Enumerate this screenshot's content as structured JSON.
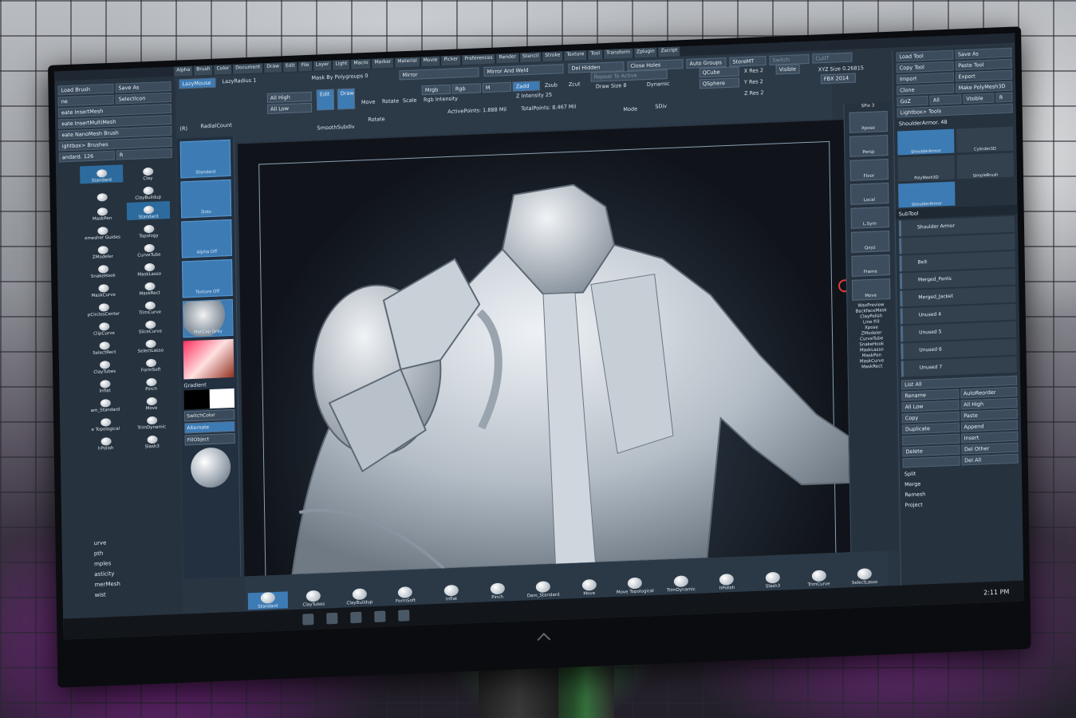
{
  "app": {
    "title_fragment": "ush"
  },
  "menu": [
    "Alpha",
    "Brush",
    "Color",
    "Document",
    "Draw",
    "Edit",
    "File",
    "Layer",
    "Light",
    "Macro",
    "Marker",
    "Material",
    "Movie",
    "Picker",
    "Preferences",
    "Render",
    "Stencil",
    "Stroke",
    "Texture",
    "Tool",
    "Transform",
    "Zplugin",
    "Zscript"
  ],
  "top_fields": {
    "lazymouse": "LazyMouse",
    "lazyradius": "LazyRadius 1",
    "mask_by_polygroups": "Mask By Polygroups 0",
    "mirror": "Mirror",
    "mirror_and_weld": "Mirror And Weld",
    "del_hidden": "Del Hidden",
    "close_holes": "Close Holes",
    "auto_groups": "Auto Groups",
    "store_mt": "StoreMT",
    "switch": "Switch",
    "cont": "CutIT",
    "xyz_size": "XYZ Size 0.26815",
    "all_high": "All High",
    "all_low": "All Low",
    "edit": "Edit",
    "draw": "Draw",
    "move": "Move",
    "rotate": "Rotate",
    "scale": "Scale",
    "mrgb": "Mrgb",
    "rgb": "Rgb",
    "m": "M",
    "zadd": "Zadd",
    "zsub": "Zsub",
    "zcut": "Zcut",
    "rgb_intensity": "Rgb Intensity",
    "z_intensity": "Z Intensity 25",
    "active_points": "ActivePoints: 1.888 Mil",
    "total_points": "TotalPoints: 8.467 Mil",
    "radial_count": "RadialCount",
    "smooth_subdiv": "SmoothSubdiv",
    "rotate2": "Rotate",
    "repeat_to_active": "Repeat To Active",
    "draw_size": "Draw Size 8",
    "dynamic": "Dynamic",
    "qcube": "QCube",
    "qsphere": "QSphere",
    "x_res": "X Res 2",
    "y_res": "Y Res 2",
    "z_res": "Z Res 2",
    "visible": "Visible",
    "fbx": "FBX 2014",
    "sdiv": "SDiv",
    "mode": "Mode",
    "r_label": "(R)"
  },
  "left_buttons": [
    [
      "Load Brush",
      "Save As"
    ],
    [
      "ne",
      "SelectIcon"
    ],
    [
      "eate InsertMesh"
    ],
    [
      "eate InsertMultiMesh"
    ],
    [
      "eate NanoMesh Brush"
    ],
    [
      "ightbox> Brushes"
    ],
    [
      "andard. 126",
      "R"
    ]
  ],
  "brushes": [
    {
      "name": "Standard",
      "sel": true
    },
    {
      "name": "Clay",
      "sel": false
    },
    {
      "name": "",
      "sel": false
    },
    {
      "name": "ClayBuildup",
      "sel": false
    },
    {
      "name": "MaskPen",
      "sel": false
    },
    {
      "name": "Standard",
      "sel": true
    },
    {
      "name": "emesher Guides",
      "sel": false
    },
    {
      "name": "Topology",
      "sel": false
    },
    {
      "name": "ZModeler",
      "sel": false
    },
    {
      "name": "CurveTube",
      "sel": false
    },
    {
      "name": "SnakeHook",
      "sel": false
    },
    {
      "name": "MaskLasso",
      "sel": false
    },
    {
      "name": "MaskCurve",
      "sel": false
    },
    {
      "name": "MaskRect",
      "sel": false
    },
    {
      "name": "pCirclesCenter",
      "sel": false
    },
    {
      "name": "TrimCurve",
      "sel": false
    },
    {
      "name": "ClipCurve",
      "sel": false
    },
    {
      "name": "SliceCurve",
      "sel": false
    },
    {
      "name": "SelectRect",
      "sel": false
    },
    {
      "name": "SelectLasso",
      "sel": false
    },
    {
      "name": "ClayTubes",
      "sel": false
    },
    {
      "name": "FormSoft",
      "sel": false
    },
    {
      "name": "Inflat",
      "sel": false
    },
    {
      "name": "Pinch",
      "sel": false
    },
    {
      "name": "am_Standard",
      "sel": false
    },
    {
      "name": "Move",
      "sel": false
    },
    {
      "name": "e Topological",
      "sel": false
    },
    {
      "name": "TrimDynamic",
      "sel": false
    },
    {
      "name": "hPolish",
      "sel": false
    },
    {
      "name": "Slash3",
      "sel": false
    }
  ],
  "left_list": [
    "urve",
    "pth",
    "mples",
    "asticity",
    "merMesh",
    "wist"
  ],
  "shelf": {
    "tiles": [
      "Standard",
      "Dots",
      "Alpha Off",
      "Texture Off",
      "MatCap Gray"
    ],
    "gradient": "Gradient",
    "switch_color": "SwitchColor",
    "alternate": "Alternate",
    "fill_object": "FillObject"
  },
  "right_tools": [
    "Xpose",
    "Persp",
    "Floor",
    "Local",
    "L.Sym",
    "Qxyz",
    "Frame",
    "Move",
    "Scale",
    "Rotate",
    "PolyF",
    "Transp",
    "Ghost",
    "Solo",
    "Xpose",
    "ZModeler",
    "CurveTube",
    "SnakeHook",
    "MaskLasso",
    "MaskPen",
    "MaskCurve",
    "MaskRect"
  ],
  "right_labels": {
    "spix": "SPix 3",
    "wax_preview": "WaxPreview",
    "backface_mask": "BackfaceMask",
    "claypolish": "ClayPolish",
    "line_fill": "Line Fill"
  },
  "rpanel": {
    "row1": [
      "Load Tool",
      "Save As"
    ],
    "row2": [
      "Copy Tool",
      "Paste Tool"
    ],
    "row3": [
      "Import",
      "Export"
    ],
    "row4": [
      "Clone",
      "Make PolyMesh3D"
    ],
    "row5": [
      "GoZ",
      "All",
      "Visible",
      "R"
    ],
    "lightbox": "Lightbox> Tools",
    "tool_name": "ShoulderArmor. 48",
    "tool_thumbs": [
      "ShoulderArmor",
      "Cylinder3D",
      "PolyMesh3D",
      "SimpleBrush",
      "ShoulderArmor"
    ],
    "subtool_header": "SubTool",
    "subtools": [
      "Shoulder Armor",
      "",
      "Belt",
      "Merged_Pants",
      "Merged_Jacket",
      "Unused 4",
      "Unused 5",
      "Unused 6",
      "Unused 7"
    ],
    "list_all": "List All",
    "ops": [
      [
        "Rename",
        "AutoReorder"
      ],
      [
        "All Low",
        "All High"
      ],
      [
        "Copy",
        "Paste"
      ],
      [
        "Duplicate",
        "Append"
      ],
      [
        "",
        "Insert"
      ],
      [
        "Delete",
        "Del Other"
      ],
      [
        "",
        "Del All"
      ]
    ],
    "split": "Split",
    "merge": "Merge",
    "remesh": "Remesh",
    "project": "Project"
  },
  "bottom_brushes": [
    "Standard",
    "ClayTubes",
    "ClayBuildup",
    "FormSoft",
    "Inflat",
    "Pinch",
    "Dam_Standard",
    "Move",
    "Move Topological",
    "TrimDynamic",
    "hPolish",
    "Slash3",
    "TrimCurve",
    "SelectLasso"
  ],
  "clock": "2:11 PM",
  "colors": {
    "accent": "#3d7bb5",
    "panel": "#26323e",
    "viewport": "#1b2430",
    "neon_purple": "#c038e0",
    "neon_green": "#4ee860"
  }
}
